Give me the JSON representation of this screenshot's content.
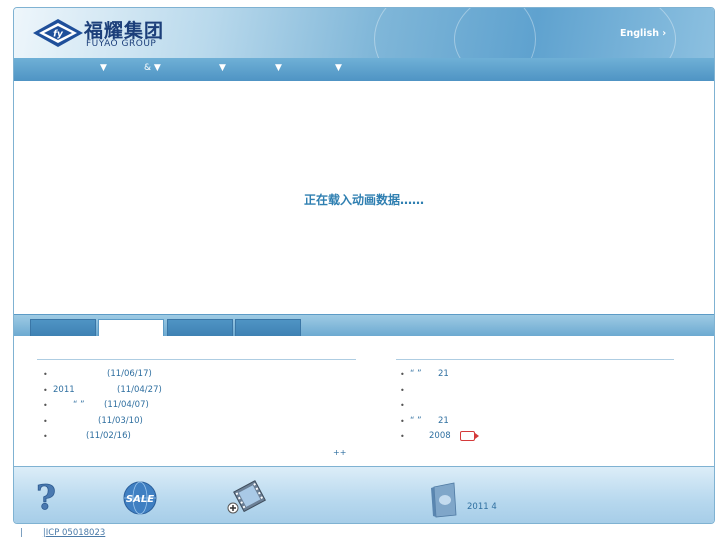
{
  "header": {
    "logo_cn": "福耀集团",
    "logo_en": "FUYAO  GROUP",
    "english_link": "English"
  },
  "nav": {
    "items": [
      {
        "label": "▼"
      },
      {
        "label": "& ▼"
      },
      {
        "label": "▼"
      },
      {
        "label": "▼"
      },
      {
        "label": "▼"
      }
    ]
  },
  "main": {
    "loading_text": "正在载入动画数据……"
  },
  "news_left": [
    {
      "text": "",
      "date": "(11/06/17)"
    },
    {
      "text": "2011",
      "date": "(11/04/27)"
    },
    {
      "text": "“     ”",
      "date": "(11/04/07)"
    },
    {
      "text": "",
      "date": "(11/03/10)"
    },
    {
      "text": "",
      "date": "(11/02/16)"
    }
  ],
  "news_right": [
    {
      "text": "“ ”",
      "extra": "21"
    },
    {
      "text": "",
      "extra": ""
    },
    {
      "text": "",
      "extra": ""
    },
    {
      "text": "“ ”",
      "extra": "21"
    },
    {
      "text": "",
      "extra": "2008"
    }
  ],
  "more_link": "++",
  "footer": {
    "report_label": "2011 4",
    "icp_parts": [
      "",
      "",
      "ICP 05018023"
    ]
  },
  "colors": {
    "accent": "#2f7fb1",
    "nav_blue": "#4f94c4",
    "logo_navy": "#1c3f7a"
  }
}
